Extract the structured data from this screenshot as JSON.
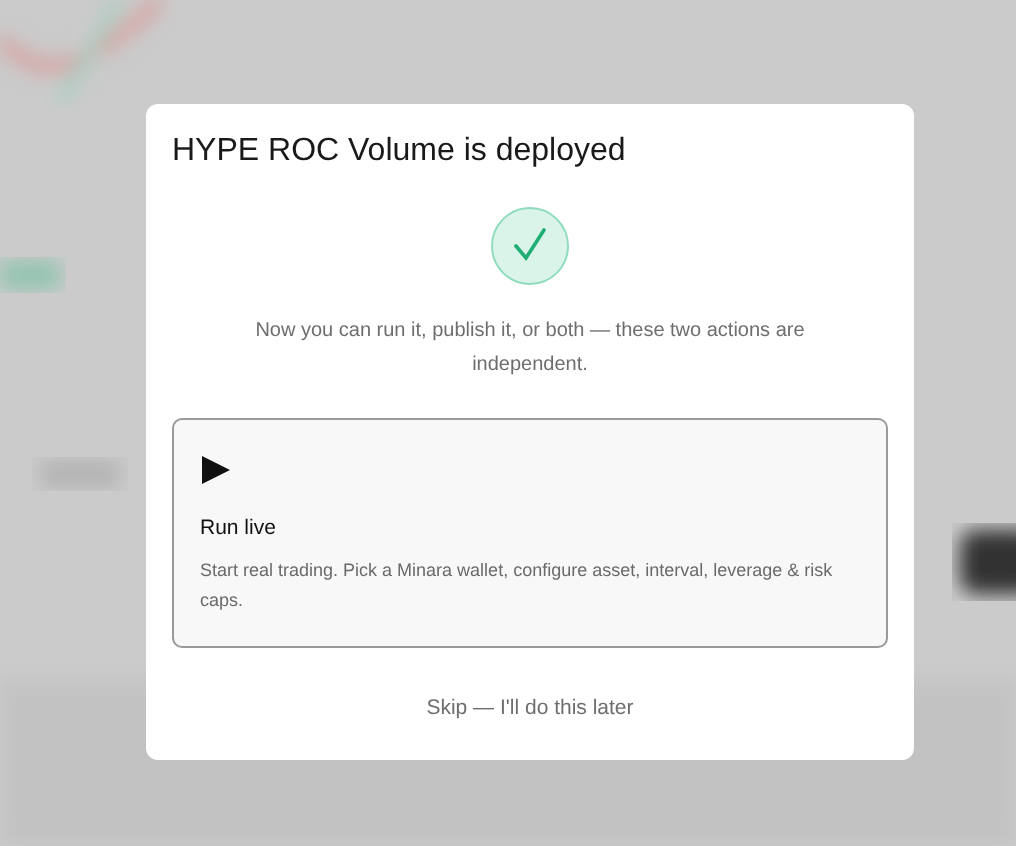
{
  "dialog": {
    "title": "HYPE ROC Volume is deployed",
    "message": "Now you can run it, publish it, or both — these two actions are independent.",
    "options": [
      {
        "kind": "run",
        "title": "Run live",
        "description": "Start real trading. Pick a Minara wallet, configure asset, interval, leverage & risk caps."
      }
    ],
    "skip_link": "Skip — I'll do this later"
  }
}
